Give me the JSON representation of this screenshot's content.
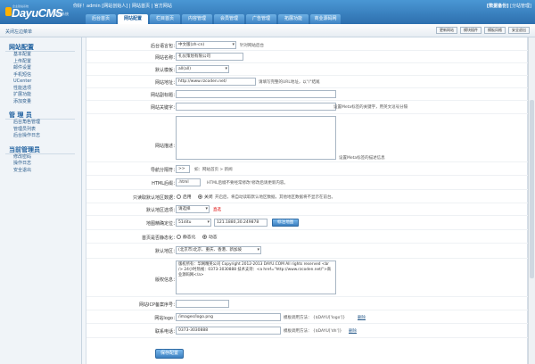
{
  "logo": {
    "brand": "DayuCMS",
    "sub": "管理系统",
    "tiny": "企业建站系统"
  },
  "header": {
    "welcome": "你好！admin [网站创始人] | 网站首页 | 官方网站",
    "links_bold": "[数据备份]",
    "links": "[分站管理]"
  },
  "nav": {
    "tabs": [
      "后台首页",
      "网站配置",
      "栏目首页",
      "内容管理",
      "会员管理",
      "广告管理",
      "拓展功能",
      "商业源码网"
    ]
  },
  "subbar": {
    "close_menu": "关闭左边菜单",
    "buttons": [
      "更新网站",
      "模块插件",
      "模板风格",
      "安全退出"
    ]
  },
  "sidebar": {
    "sections": [
      {
        "title": "网站配置",
        "items": [
          "基本配置",
          "上传配置",
          "邮件设置",
          "手机短信",
          "UCenter",
          "性能选项",
          "扩展功能",
          "添加变量"
        ]
      },
      {
        "title": "管 理 员",
        "items": [
          "后台角色管理",
          "管理员列表",
          "后台操作日志"
        ]
      },
      {
        "title": "当前管理员",
        "items": [
          "修改密码",
          "操作日志",
          "安全退出"
        ]
      }
    ]
  },
  "form": {
    "lang_label": "后台语言包：",
    "lang_value": "中文版(zh-cn)",
    "lang_hint": "针对网站后台",
    "sitename_label": "网站名称：",
    "sitename_value": "礼仪策划有限公司",
    "template_label": "默认模板：",
    "template_value": "all(all)",
    "siteurl_label": "网站地址：",
    "siteurl_value": "http://www.rzcoden.net/",
    "siteurl_hint": "请填写完整的URL地址，以\"/\"结尾",
    "title_label": "网站副标题：",
    "keywords_label": "网站关键字：",
    "keywords_hint": "设置Meta标签的关键字，用英文逗号分隔",
    "desc_label": "网站描述：",
    "desc_hint": "设置Meta标签的描述信息",
    "sep_label": "导航分隔符：",
    "sep_value": ">>",
    "sep_hint": "如：网站首页 > 新闻",
    "html_label": "HTML后缀：",
    "html_value": ".html",
    "html_hint": "HTML后缀不要经常修改!修改后请更新内容。",
    "region_label": "只读取默认地区数据：",
    "region_on": "启用",
    "region_off": "关闭",
    "region_hint": "开启后，将自动读取默认地区数据，其他地区数据将不显示在前台。",
    "default_region_label": "默认地区选项：",
    "default_region_value": "请选择",
    "default_region_hint": "直选",
    "map_label": "地图精确定位：",
    "map_select": "51ditu",
    "map_value": "121.1880,30.249878",
    "map_button": "标注地图",
    "static_label": "首页是否静态化：",
    "static_on": "静态化",
    "static_off": "动态",
    "area_label": "默认地区：",
    "area_value": "(北京市)北京、重庆、香港、新加坡",
    "copyright_label": "版权信息：",
    "copyright_value": "版权所有：华网精英公司 Copyright 2012-2013 DAYU.COM All rights reserved <br /> 24小时热线：0373-3030888 技术支持：<a href=\"http://www.rzcoden.net/\">商业源码网</a>",
    "icp_label": "网站ICP备案序号：",
    "logo_label": "网站logo：",
    "logo_value": "/images/logo.png",
    "logo_hint": "模板调用方法：  {$DAYU['logo']}",
    "logo_link": "删除",
    "tel_label": "联系电话：",
    "tel_value": "0373-3030888",
    "tel_hint": "模板调用方法：  {$DAYU['dh']}",
    "tel_link": "删除",
    "save": "保存配置"
  }
}
